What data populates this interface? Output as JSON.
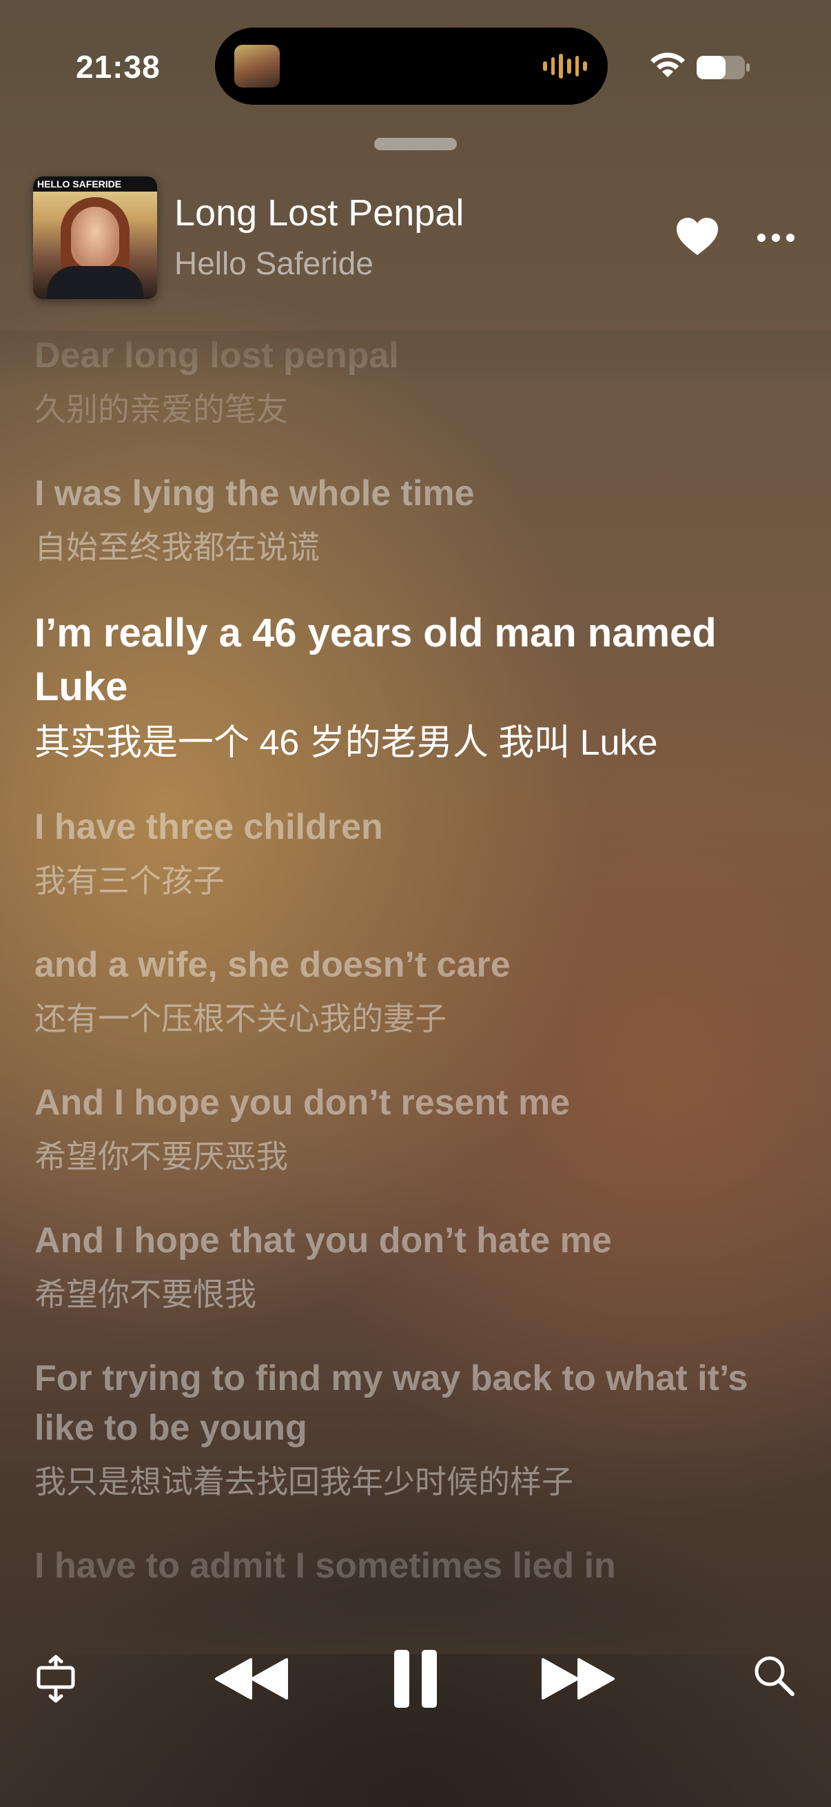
{
  "status_bar": {
    "time": "21:38"
  },
  "now_playing": {
    "album_art_text": "HELLO SAFERIDE",
    "title": "Long Lost Penpal",
    "artist": "Hello Saferide"
  },
  "lyrics": [
    {
      "en": "Dear long lost penpal",
      "zh": "久别的亲爱的笔友",
      "state": "faded"
    },
    {
      "en": "I was lying the whole time",
      "zh": "自始至终我都在说谎",
      "state": "dim"
    },
    {
      "en": "I’m really a 46 years old man named Luke",
      "zh": "其实我是一个 46 岁的老男人 我叫 Luke",
      "state": "active"
    },
    {
      "en": "I have three children",
      "zh": "我有三个孩子",
      "state": "dim"
    },
    {
      "en": "and a wife, she doesn’t care",
      "zh": "还有一个压根不关心我的妻子",
      "state": "dim"
    },
    {
      "en": "And I hope you don’t resent me",
      "zh": "希望你不要厌恶我",
      "state": "dim"
    },
    {
      "en": "And I hope that you don’t hate me",
      "zh": "希望你不要恨我",
      "state": "dim"
    },
    {
      "en": "For trying to find my way back to what it’s like to be young",
      "zh": "我只是想试着去找回我年少时候的样子",
      "state": "dim"
    },
    {
      "en": "I have to admit I sometimes lied in",
      "zh": "",
      "state": "faded"
    }
  ],
  "colors": {
    "accent_wave": "#d6a24a",
    "text_primary": "#ffffff"
  }
}
